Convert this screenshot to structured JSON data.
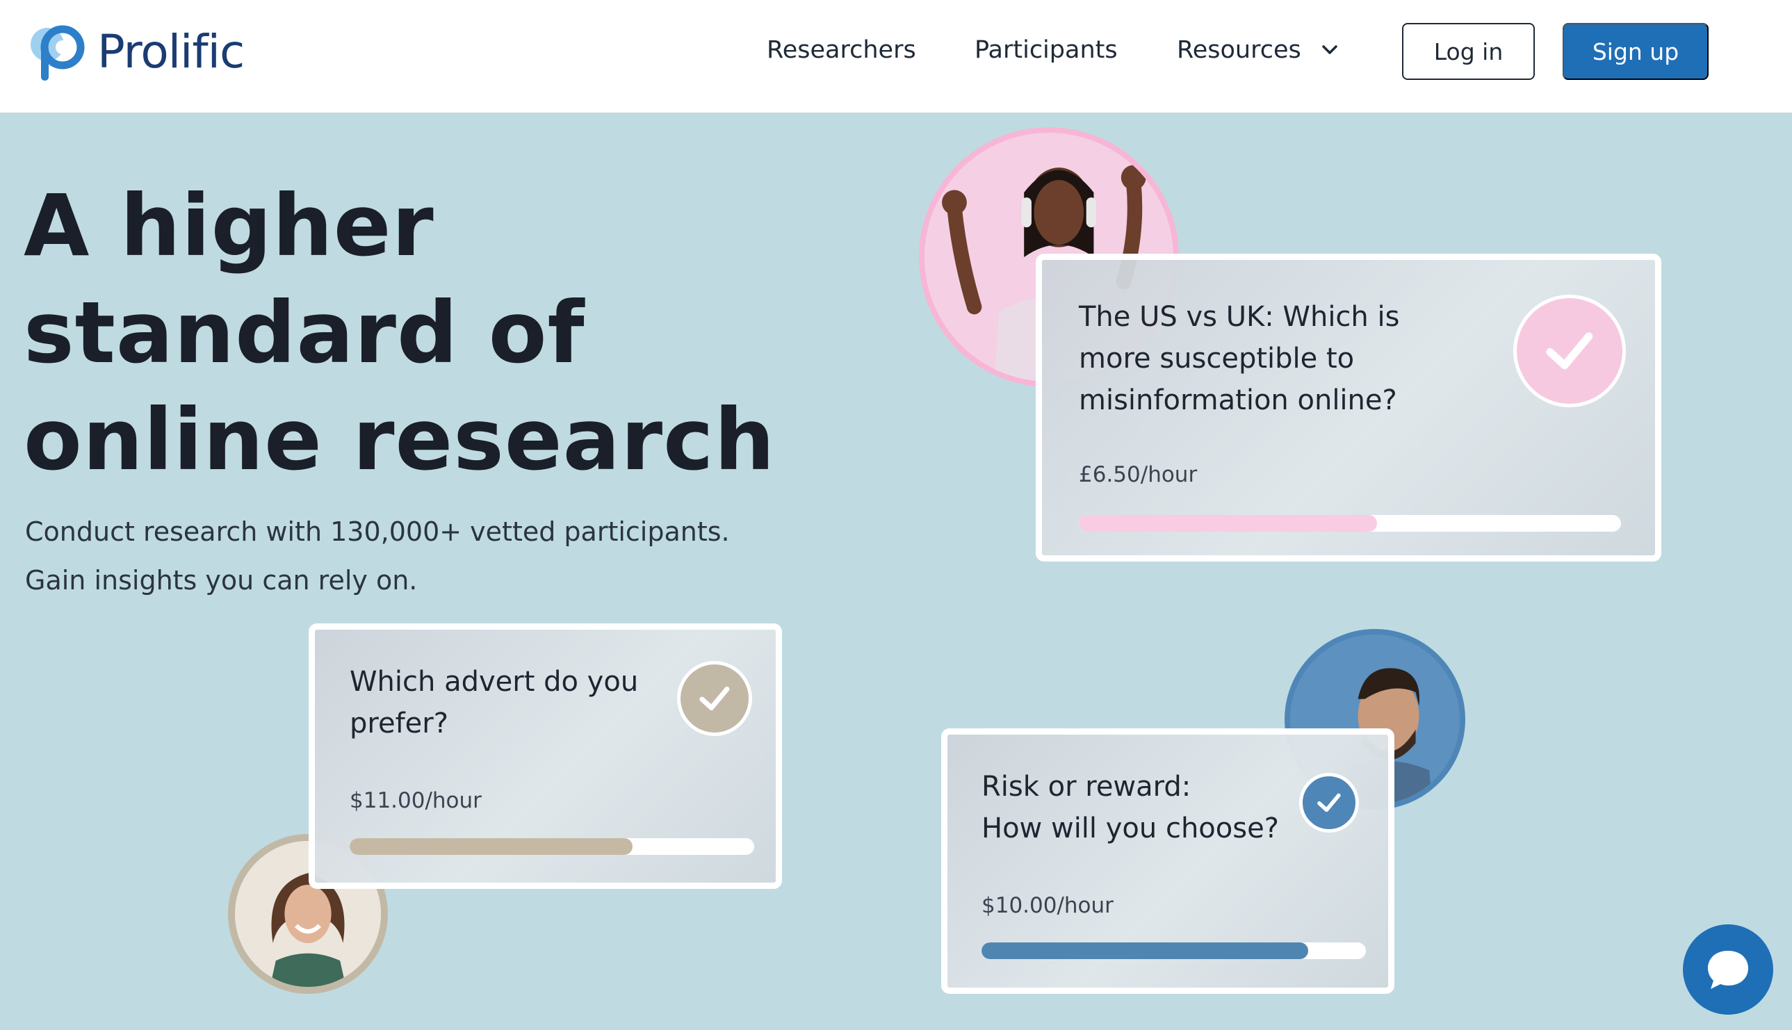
{
  "brand": {
    "name": "Prolific"
  },
  "nav": {
    "researchers": "Researchers",
    "participants": "Participants",
    "resources": "Resources",
    "login": "Log in",
    "signup": "Sign up"
  },
  "hero": {
    "title_line1": "A higher",
    "title_line2": "standard of",
    "title_line3": "online research",
    "sub_line1": "Conduct research with 130,000+ vetted participants.",
    "sub_line2": "Gain insights you can rely on."
  },
  "studies": [
    {
      "question": "The US vs UK: Which is more susceptible to misinformation online?",
      "rate": "£6.50/hour",
      "progress": 0.55,
      "accent": "#f9cce3",
      "check_color": "#f7c9e0"
    },
    {
      "question": "Which advert do you prefer?",
      "rate": "$11.00/hour",
      "progress": 0.7,
      "accent": "#c6b9a4",
      "check_color": "#c2b8a6"
    },
    {
      "question_line1": "Risk or reward:",
      "question_line2": "How will you choose?",
      "rate": "$10.00/hour",
      "progress": 0.85,
      "accent": "#4f86b1",
      "check_color": "#4f86b8"
    }
  ],
  "colors": {
    "background": "#bfdbe1",
    "primary": "#1f6fb7",
    "logo": "#1a3c72"
  },
  "icons": {
    "logo": "prolific-logo-icon",
    "resources_dropdown": "chevron-down-icon",
    "check": "checkmark-icon",
    "chat": "chat-bubble-icon"
  }
}
